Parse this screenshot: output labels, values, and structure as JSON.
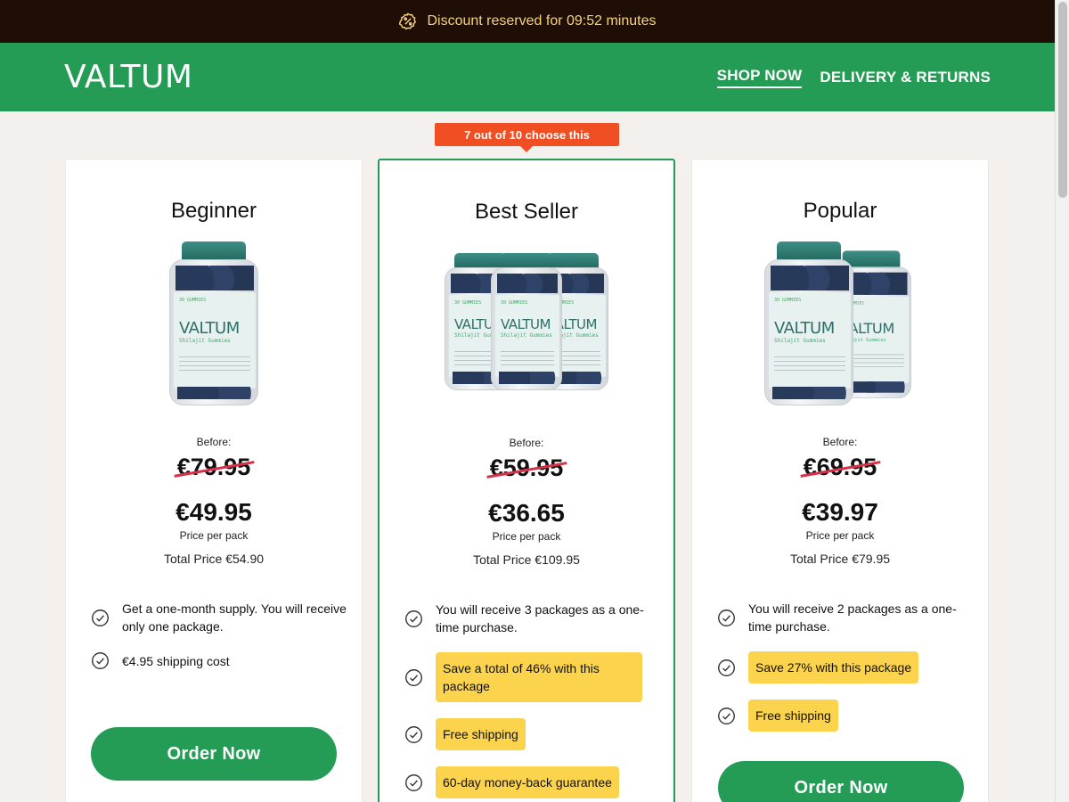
{
  "topbar": {
    "text": "Discount reserved for 09:52 minutes",
    "icon": "discount-badge-icon"
  },
  "header": {
    "brand": "VALTUM",
    "nav": [
      {
        "label": "SHOP NOW",
        "active": true
      },
      {
        "label": "DELIVERY & RETURNS",
        "active": false
      }
    ]
  },
  "ribbon": {
    "text": "7 out of 10 choose this"
  },
  "colors": {
    "brand_green": "#259c56",
    "topbar_bg": "#1f0e05",
    "topbar_text": "#f5d27a",
    "ribbon": "#f04e23",
    "highlight": "#fcd34d",
    "strike": "#d6304a"
  },
  "plans": [
    {
      "title": "Beginner",
      "before_label": "Before:",
      "old_price": "€79.95",
      "price": "€49.95",
      "per_pack": "Price per pack",
      "total": "Total Price €54.90",
      "features": [
        "Get a one-month supply. You will receive only one package.",
        "€4.95 shipping cost"
      ],
      "cta": "Order Now"
    },
    {
      "title": "Best Seller",
      "before_label": "Before:",
      "old_price": "€59.95",
      "price": "€36.65",
      "per_pack": "Price per pack",
      "total": "Total Price €109.95",
      "features": [
        "You will receive 3 packages as a one-time purchase.",
        "Save a total of 46% with this package",
        "Free shipping",
        "60-day money-back guarantee"
      ]
    },
    {
      "title": "Popular",
      "before_label": "Before:",
      "old_price": "€69.95",
      "price": "€39.97",
      "per_pack": "Price per pack",
      "total": "Total Price €79.95",
      "features": [
        "You will receive 2 packages as a one-time purchase.",
        "Save 27% with this package",
        "Free shipping"
      ],
      "cta": "Order Now"
    }
  ],
  "bottle_label": {
    "small": "30 GUMMIES",
    "brand": "VALTUM",
    "sub": "Shilajit Gummies"
  }
}
